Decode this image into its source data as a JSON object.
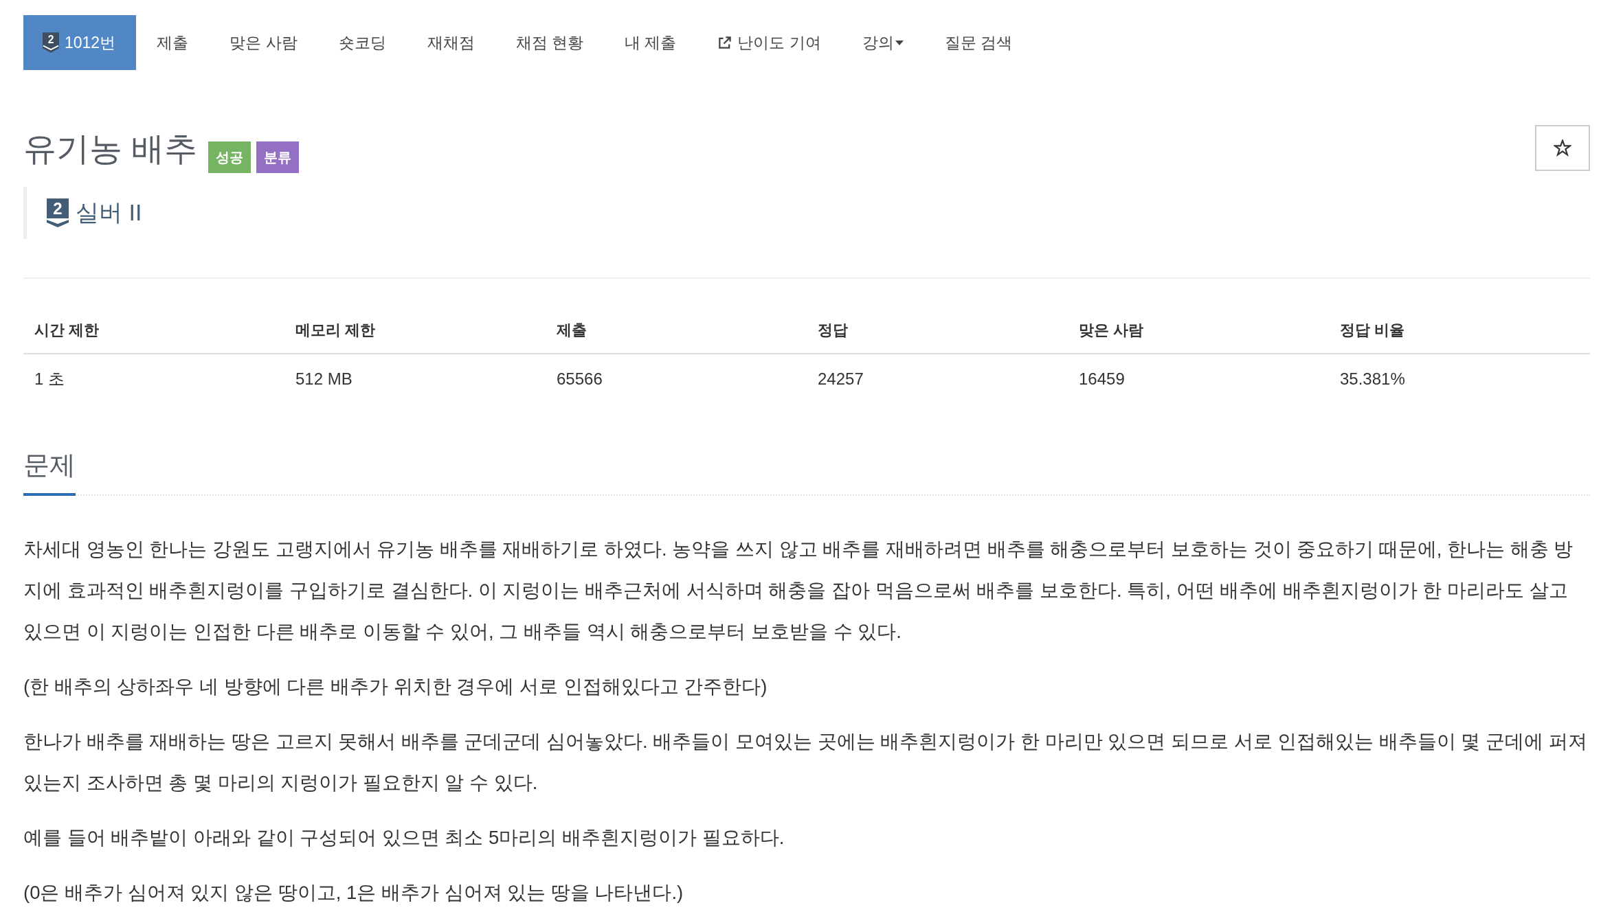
{
  "nav": [
    {
      "kind": "problem",
      "badge": "2",
      "label": "1012번",
      "selected": true
    },
    {
      "kind": "link",
      "label": "제출",
      "selected": false
    },
    {
      "kind": "link",
      "label": "맞은 사람",
      "selected": false
    },
    {
      "kind": "link",
      "label": "숏코딩",
      "selected": false
    },
    {
      "kind": "link",
      "label": "재채점",
      "selected": false
    },
    {
      "kind": "link",
      "label": "채점 현황",
      "selected": false
    },
    {
      "kind": "link",
      "label": "내 제출",
      "selected": false
    },
    {
      "kind": "external",
      "label": "난이도 기여",
      "selected": false
    },
    {
      "kind": "dropdown",
      "label": "강의",
      "selected": false
    },
    {
      "kind": "link",
      "label": "질문 검색",
      "selected": false
    }
  ],
  "problem": {
    "title": "유기농 배추",
    "labels": [
      {
        "text": "성공",
        "color": "#76b464"
      },
      {
        "text": "분류",
        "color": "#9470c4"
      }
    ],
    "starred": false,
    "tier": {
      "badge": "2",
      "name": "실버 II"
    }
  },
  "table": {
    "columns": [
      "시간 제한",
      "메모리 제한",
      "제출",
      "정답",
      "맞은 사람",
      "정답 비율"
    ],
    "rows": [
      [
        "1 초",
        "512 MB",
        "65566",
        "24257",
        "16459",
        "35.381%"
      ]
    ]
  },
  "section": {
    "heading": "문제",
    "paragraphs": [
      "차세대 영농인 한나는 강원도 고랭지에서 유기농 배추를 재배하기로 하였다. 농약을 쓰지 않고 배추를 재배하려면 배추를 해충으로부터 보호하는 것이 중요하기 때문에, 한나는 해충 방지에 효과적인 배추흰지렁이를 구입하기로 결심한다. 이 지렁이는 배추근처에 서식하며 해충을 잡아 먹음으로써 배추를 보호한다. 특히, 어떤 배추에 배추흰지렁이가 한 마리라도 살고 있으면 이 지렁이는 인접한 다른 배추로 이동할 수 있어, 그 배추들 역시 해충으로부터 보호받을 수 있다.",
      "(한 배추의 상하좌우 네 방향에 다른 배추가 위치한 경우에 서로 인접해있다고 간주한다)",
      "한나가 배추를 재배하는 땅은 고르지 못해서 배추를 군데군데 심어놓았다. 배추들이 모여있는 곳에는 배추흰지렁이가 한 마리만 있으면 되므로 서로 인접해있는 배추들이 몇 군데에 퍼져있는지 조사하면 총 몇 마리의 지렁이가 필요한지 알 수 있다.",
      "예를 들어 배추밭이 아래와 같이 구성되어 있으면 최소 5마리의 배추흰지렁이가 필요하다.",
      "(0은 배추가 심어져 있지 않은 땅이고, 1은 배추가 심어져 있는 땅을 나타낸다.)"
    ]
  }
}
